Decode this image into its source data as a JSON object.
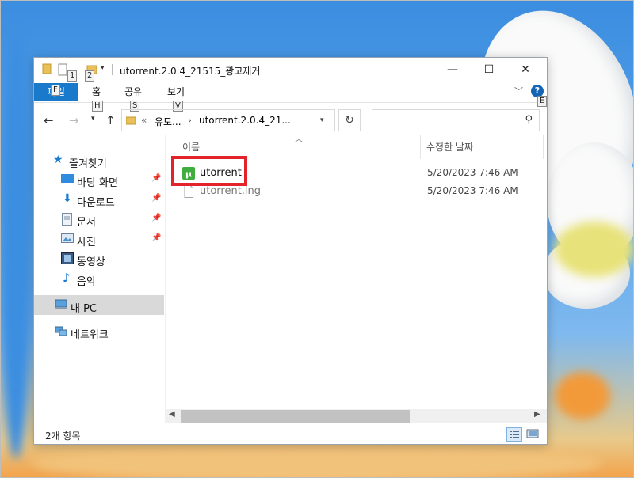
{
  "window": {
    "title": "utorrent.2.0.4_21515_광고제거",
    "keytips": {
      "qa1": "1",
      "qa2": "2",
      "file": "F",
      "home": "H",
      "share": "S",
      "view": "V",
      "help": "E"
    },
    "controls": {
      "minimize": "—",
      "maximize": "☐",
      "close": "✕"
    }
  },
  "ribbon": {
    "tabs": {
      "file": "파일",
      "home": "홈",
      "share": "공유",
      "view": "보기"
    }
  },
  "address": {
    "overflow": "«",
    "segment1": "유토...",
    "separator": "›",
    "segment2": "utorrent.2.0.4_21...",
    "search_placeholder": ""
  },
  "nav": {
    "quick_access": "즐겨찾기",
    "items": [
      {
        "label": "바탕 화면",
        "pinned": true
      },
      {
        "label": "다운로드",
        "pinned": true
      },
      {
        "label": "문서",
        "pinned": true
      },
      {
        "label": "사진",
        "pinned": true
      },
      {
        "label": "동영상",
        "pinned": false
      },
      {
        "label": "음악",
        "pinned": false
      }
    ],
    "this_pc": "내 PC",
    "network": "네트워크"
  },
  "columns": {
    "name": "이름",
    "modified": "수정한 날짜"
  },
  "files": [
    {
      "name": "utorrent",
      "date": "5/20/2023 7:46 AM",
      "icon": "utorrent-app-icon"
    },
    {
      "name": "utorrent.lng",
      "date": "5/20/2023 7:46 AM",
      "icon": "generic-file-icon"
    }
  ],
  "status": {
    "item_count": "2개 항목"
  },
  "colors": {
    "accent": "#1979ca",
    "highlight": "#e3232a",
    "utorrent_green": "#3fae3f"
  }
}
